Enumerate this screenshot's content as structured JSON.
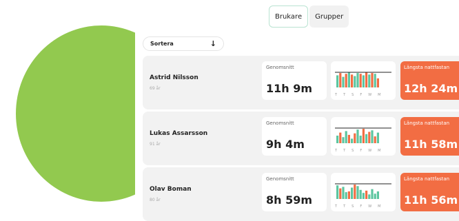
{
  "tabs": [
    {
      "label": "Brukare",
      "active": true
    },
    {
      "label": "Grupper",
      "active": false
    }
  ],
  "sort": {
    "label": "Sortera",
    "icon": "arrow-down-icon"
  },
  "colors": {
    "green_blob": "#92c94f",
    "bar_green": "#5cc6a0",
    "bar_red": "#f26d43",
    "longest_bg": "#f26d43",
    "tab_border": "#b9e3d1"
  },
  "rows": [
    {
      "name": "Astrid Nilsson",
      "age": "69 år",
      "avg_label": "Genomsnitt",
      "avg_value": "11h 9m",
      "days": [
        "T",
        "T",
        "S",
        "F",
        "W",
        "M"
      ],
      "bars": [
        0.8,
        0.95,
        0.7,
        0.9,
        1.0,
        0.85,
        0.75,
        0.95,
        0.9,
        0.8,
        1.0,
        0.85,
        0.95,
        0.9,
        0.6
      ],
      "bar_colors": [
        "green",
        "red",
        "green",
        "red",
        "green",
        "red",
        "green",
        "green",
        "red",
        "green",
        "red",
        "green",
        "red",
        "green",
        "red"
      ],
      "longest_label": "Längsta nattfastan",
      "longest_value": "12h 24m"
    },
    {
      "name": "Lukas Assarsson",
      "age": "91 år",
      "avg_label": "Genomsnitt",
      "avg_value": "9h 4m",
      "days": [
        "T",
        "T",
        "S",
        "F",
        "W",
        "M"
      ],
      "bars": [
        0.5,
        0.7,
        0.4,
        0.8,
        0.55,
        0.3,
        0.65,
        0.9,
        0.5,
        0.95,
        0.6,
        0.75,
        0.85,
        0.45,
        0.7
      ],
      "bar_colors": [
        "green",
        "red",
        "green",
        "green",
        "red",
        "green",
        "red",
        "green",
        "green",
        "red",
        "green",
        "red",
        "green",
        "red",
        "green"
      ],
      "longest_label": "Längsta nattfastan",
      "longest_value": "11h 58m"
    },
    {
      "name": "Olav Boman",
      "age": "80 år",
      "avg_label": "Genomsnitt",
      "avg_value": "8h 59m",
      "days": [
        "T",
        "T",
        "S",
        "F",
        "W",
        "M"
      ],
      "bars": [
        0.9,
        0.7,
        0.8,
        0.45,
        0.5,
        0.75,
        0.95,
        0.85,
        0.6,
        0.4,
        0.55,
        0.3,
        0.65,
        0.35,
        0.5
      ],
      "bar_colors": [
        "green",
        "red",
        "green",
        "green",
        "red",
        "green",
        "red",
        "green",
        "green",
        "green",
        "red",
        "green",
        "green",
        "green",
        "green"
      ],
      "longest_label": "Längsta nattfastan",
      "longest_value": "11h 56m"
    }
  ]
}
